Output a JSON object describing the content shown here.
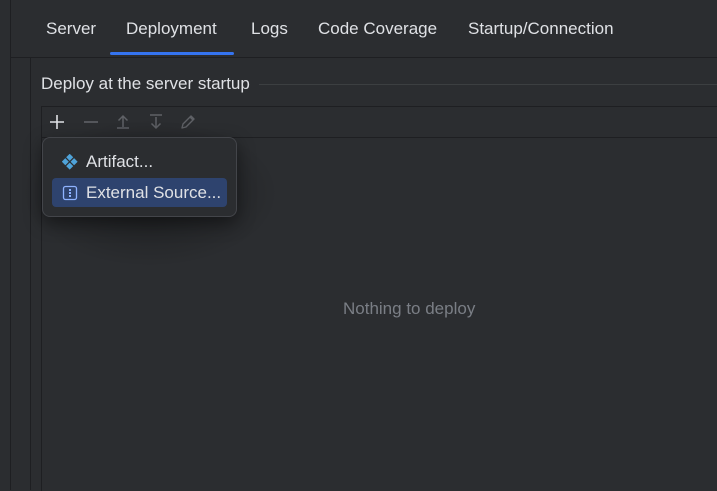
{
  "tabs": [
    {
      "label": "Server"
    },
    {
      "label": "Deployment",
      "active": true
    },
    {
      "label": "Logs"
    },
    {
      "label": "Code Coverage"
    },
    {
      "label": "Startup/Connection"
    }
  ],
  "group": {
    "title": "Deploy at the server startup"
  },
  "toolbar": {
    "icons": [
      "add-icon",
      "remove-icon",
      "move-up-icon",
      "move-down-icon",
      "edit-icon"
    ]
  },
  "list": {
    "empty_text": "Nothing to deploy"
  },
  "popup": {
    "items": [
      {
        "label": "Artifact...",
        "icon": "artifact-icon",
        "selected": false
      },
      {
        "label": "External Source...",
        "icon": "external-source-icon",
        "selected": true
      }
    ]
  },
  "colors": {
    "background": "#2b2d30",
    "accent": "#3574f0",
    "selection": "#2e436e",
    "artifact_icon": "#4fa3d9",
    "muted_text": "#7a7e85"
  }
}
